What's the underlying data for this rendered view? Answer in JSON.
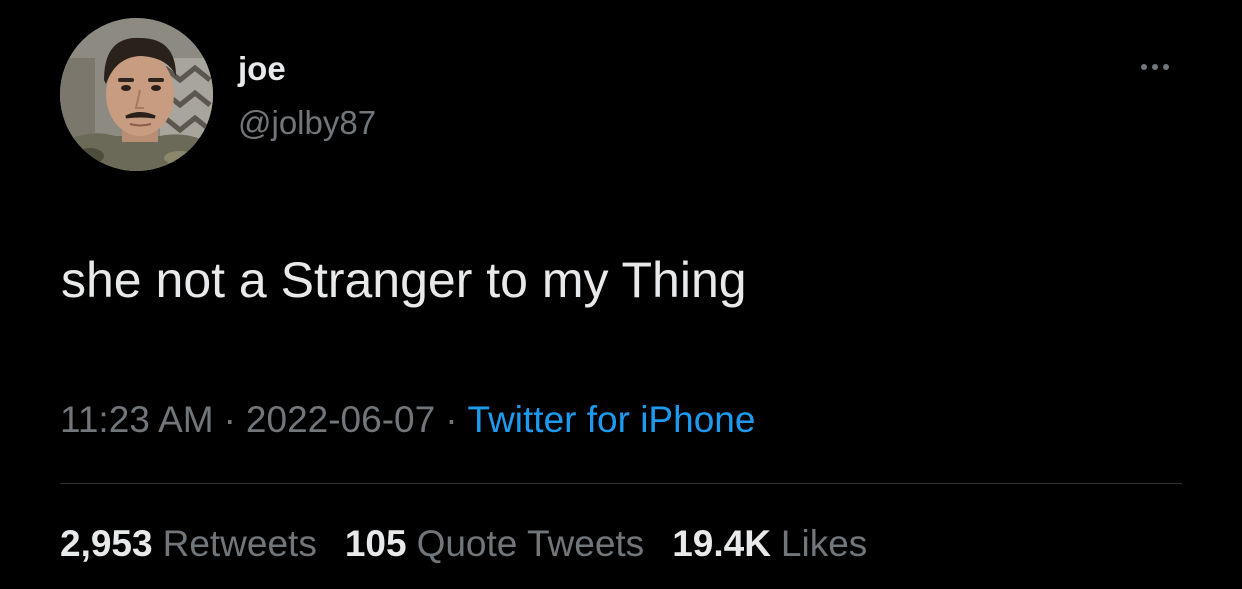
{
  "user": {
    "name": "joe",
    "handle": "@jolby87"
  },
  "tweet": {
    "text": "she not a Stranger to my Thing"
  },
  "meta": {
    "time": "11:23 AM",
    "separator": "·",
    "date": "2022-06-07",
    "source": "Twitter for iPhone"
  },
  "stats": {
    "retweets_count": "2,953",
    "retweets_label": "Retweets",
    "quotes_count": "105",
    "quotes_label": "Quote Tweets",
    "likes_count": "19.4K",
    "likes_label": "Likes"
  },
  "icons": {
    "more": "more-horizontal-icon"
  },
  "colors": {
    "background": "#000000",
    "primary_text": "#e7e9ea",
    "secondary_text": "#71767b",
    "link": "#1d9bf0",
    "divider": "#2f3336"
  }
}
